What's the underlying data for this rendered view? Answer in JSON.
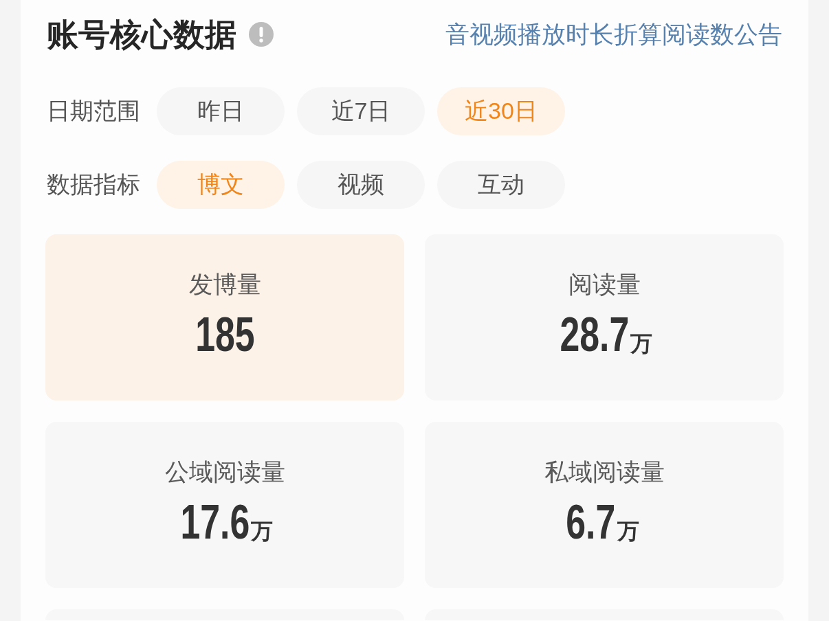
{
  "header": {
    "title": "账号核心数据",
    "link": "音视频播放时长折算阅读数公告"
  },
  "filters": [
    {
      "label": "日期范围",
      "options": [
        {
          "label": "昨日",
          "selected": false
        },
        {
          "label": "近7日",
          "selected": false
        },
        {
          "label": "近30日",
          "selected": true
        }
      ]
    },
    {
      "label": "数据指标",
      "options": [
        {
          "label": "博文",
          "selected": true
        },
        {
          "label": "视频",
          "selected": false
        },
        {
          "label": "互动",
          "selected": false
        }
      ]
    }
  ],
  "stats": [
    {
      "kind": "metric",
      "label": "发博量",
      "value": "185",
      "selected": true
    },
    {
      "kind": "metric",
      "label": "阅读量",
      "value": "28.7",
      "unit": "万",
      "selected": false
    },
    {
      "kind": "metric",
      "label": "公域阅读量",
      "value": "17.6",
      "unit": "万",
      "selected": false
    },
    {
      "kind": "metric",
      "label": "私域阅读量",
      "value": "6.7",
      "unit": "万",
      "selected": false
    },
    {
      "kind": "cut_off",
      "selected": false
    },
    {
      "kind": "cut_off",
      "selected": false
    }
  ]
}
